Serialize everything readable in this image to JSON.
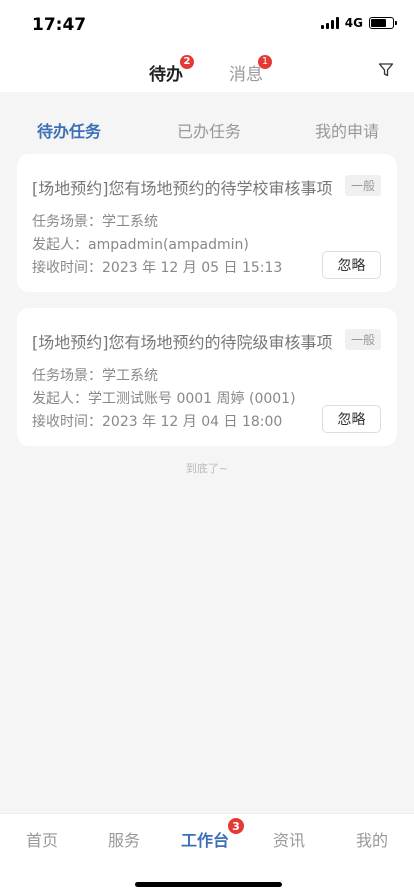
{
  "status_bar": {
    "time": "17:47",
    "network": "4G",
    "signal_icon": "signal-bars-icon",
    "battery_icon": "battery-icon",
    "battery_level": 0.7
  },
  "header": {
    "tabs": [
      {
        "label": "待办",
        "badge": "2",
        "active": true
      },
      {
        "label": "消息",
        "badge": "1",
        "active": false
      }
    ],
    "filter_icon": "filter-icon"
  },
  "sub_tabs": [
    {
      "label": "待办任务",
      "active": true
    },
    {
      "label": "已办任务",
      "active": false
    },
    {
      "label": "我的申请",
      "active": false
    }
  ],
  "tasks": [
    {
      "title": "[场地预约]您有场地预约的待学校审核事项",
      "tag": "一般",
      "scene": "任务场景：学工系统",
      "initiator": "发起人：ampadmin(ampadmin)",
      "received": "接收时间：2023 年 12 月 05 日 15:13",
      "action": "忽略"
    },
    {
      "title": "[场地预约]您有场地预约的待院级审核事项",
      "tag": "一般",
      "scene": "任务场景：学工系统",
      "initiator": "发起人：学工测试账号 0001 周婷 (0001)",
      "received": "接收时间：2023 年 12 月 04 日 18:00",
      "action": "忽略"
    }
  ],
  "end_text": "到底了~",
  "bottom_nav": [
    {
      "label": "首页",
      "active": false
    },
    {
      "label": "服务",
      "active": false
    },
    {
      "label": "工作台",
      "active": true,
      "badge": "3"
    },
    {
      "label": "资讯",
      "active": false
    },
    {
      "label": "我的",
      "active": false
    }
  ],
  "colors": {
    "accent": "#3b6fb6",
    "badge": "#e53935",
    "background": "#f5f5f5"
  }
}
